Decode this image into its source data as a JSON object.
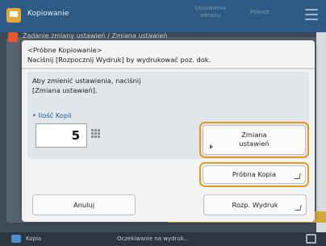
{
  "titlebar": {
    "app_title": "Kopiowanie",
    "right_label_1": "Ustawienia",
    "right_label_1b": "ekranu",
    "right_label_2": "Powrót"
  },
  "background": {
    "peek_text": "Żądanie zmiany ustawień / Zmiana ustawień"
  },
  "dialog": {
    "title_line1": "<Próbne Kopiowanie>",
    "title_line2": "Naciśnij [Rozpocznij Wydruk] by wydrukować poz. dok.",
    "instruction_line1": "Aby zmienić ustawienia, naciśnij",
    "instruction_line2": "[Zmiana ustawień].",
    "copies_label": "• Ilość Kopii",
    "copies_value": "5",
    "change_settings_line1": "Zmiana",
    "change_settings_line2": "ustawień",
    "sample_copy_label": "Próbna Kopia",
    "cancel_label": "Anuluj",
    "start_print_label": "Rozp. Wydruk"
  },
  "statusbar": {
    "app_label": "Kopia",
    "message": "Oczekiwanie na wydruk..."
  },
  "colors": {
    "highlight": "#e59a1e",
    "titlebar": "#2d5b86",
    "accent_text": "#1a5a94"
  }
}
